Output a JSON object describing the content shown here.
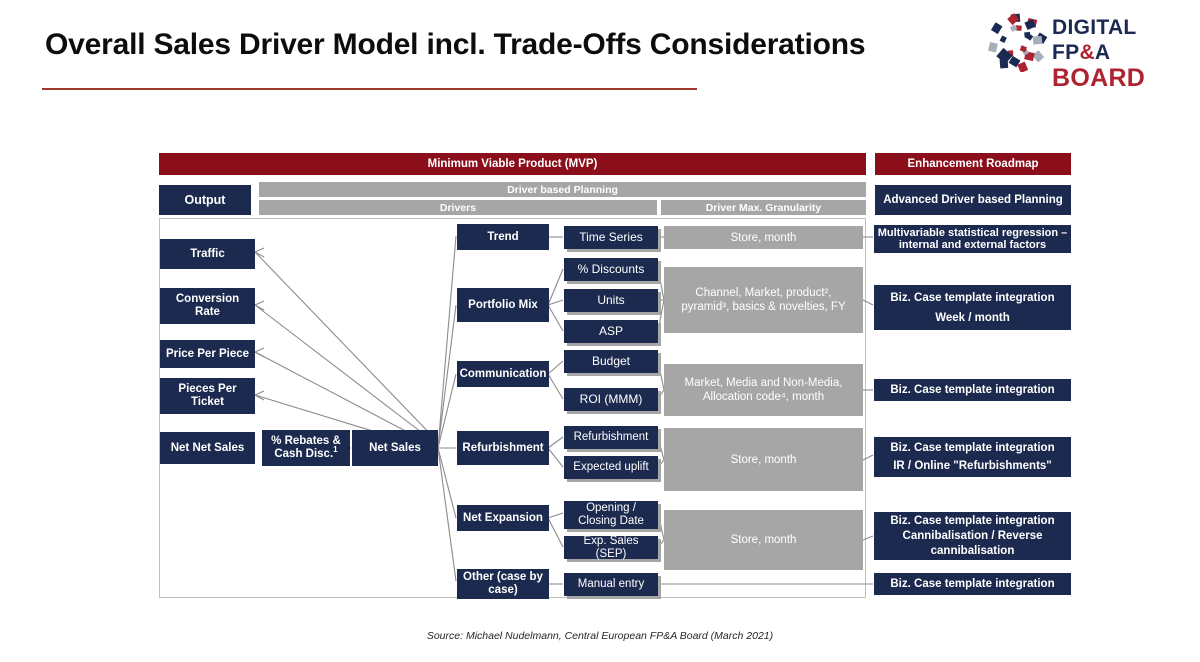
{
  "header": {
    "title": "Overall Sales Driver Model incl. Trade-Offs Considerations",
    "rule_color": "#9E3A2B",
    "logo": {
      "line1_pre": "DIGITAL FP",
      "line1_amp": "&",
      "line1_post": "A",
      "line2": "BOARD",
      "mark_name": "digital-fpa-board-swirl-logo",
      "colors": {
        "navy": "#1B2A52",
        "red": "#AE2330",
        "gray": "#A6AEBB"
      }
    }
  },
  "colors": {
    "navy": "#1B2A4E",
    "gray": "#A6A6A6",
    "dark_red": "#8B0E1B",
    "frame": "#BFBFBF",
    "connector": "#8C8C8C"
  },
  "banners": {
    "mvp": "Minimum Viable Product (MVP)",
    "enhancement_roadmap": "Enhancement Roadmap"
  },
  "row_labels": {
    "output": "Output",
    "driver_based_planning": "Driver based Planning",
    "drivers": "Drivers",
    "driver_max_granularity": "Driver Max. Granularity",
    "advanced_driver_based_planning": "Advanced Driver based Planning"
  },
  "output_metrics": [
    {
      "label": "Traffic"
    },
    {
      "label": "Conversion Rate"
    },
    {
      "label": "Price Per Piece"
    },
    {
      "label": "Pieces Per Ticket"
    },
    {
      "label": "Net Net Sales"
    }
  ],
  "bridge_boxes": [
    {
      "name": "rebates-cash-discount",
      "label": "% Rebates & Cash Disc.",
      "footnote": "1"
    },
    {
      "name": "net-sales",
      "label": "Net Sales",
      "footnote": ""
    }
  ],
  "drivers": [
    {
      "name": "trend",
      "label": "Trend",
      "sub_drivers": [
        {
          "label": "Time Series"
        }
      ],
      "granularity": {
        "lines": [
          "Store, month"
        ],
        "footnotes": []
      },
      "roadmap": {
        "lines": [
          "Multivariable statistical regression – internal and external factors"
        ]
      }
    },
    {
      "name": "portfolio-mix",
      "label": "Portfolio Mix",
      "sub_drivers": [
        {
          "label": "% Discounts"
        },
        {
          "label": "Units"
        },
        {
          "label": "ASP"
        }
      ],
      "granularity": {
        "lines": [
          "Channel, Market, product²,",
          "pyramid³, basics & novelties, FY"
        ],
        "footnotes": [
          "2",
          "3"
        ]
      },
      "roadmap": {
        "lines": [
          "Biz. Case template integration",
          "Week / month"
        ]
      }
    },
    {
      "name": "communication",
      "label": "Communication",
      "sub_drivers": [
        {
          "label": "Budget"
        },
        {
          "label": "ROI (MMM)"
        }
      ],
      "granularity": {
        "lines": [
          "Market, Media and Non-Media,",
          "Allocation code⁴, month"
        ],
        "footnotes": [
          "4"
        ]
      },
      "roadmap": {
        "lines": [
          "Biz. Case template integration"
        ]
      }
    },
    {
      "name": "refurbishment",
      "label": "Refurbishment",
      "sub_drivers": [
        {
          "label": "Refurbishment"
        },
        {
          "label": "Expected uplift"
        }
      ],
      "granularity": {
        "lines": [
          "Store, month"
        ],
        "footnotes": []
      },
      "roadmap": {
        "lines": [
          "Biz. Case template integration",
          "IR / Online \"Refurbishments\""
        ]
      }
    },
    {
      "name": "net-expansion",
      "label": "Net Expansion",
      "sub_drivers": [
        {
          "label": "Opening / Closing Date"
        },
        {
          "label": "Exp. Sales (SEP)"
        }
      ],
      "granularity": {
        "lines": [
          "Store, month"
        ],
        "footnotes": []
      },
      "roadmap": {
        "lines": [
          "Biz. Case template integration",
          "Cannibalisation / Reverse cannibalisation"
        ]
      }
    },
    {
      "name": "other-case-by-case",
      "label": "Other (case by case)",
      "sub_drivers": [
        {
          "label": "Manual entry"
        }
      ],
      "granularity": {
        "lines": [],
        "footnotes": []
      },
      "roadmap": {
        "lines": [
          "Biz. Case template integration"
        ]
      }
    }
  ],
  "sub_driver_flat": [
    "Time Series",
    "% Discounts",
    "Units",
    "ASP",
    "Budget",
    "ROI (MMM)",
    "Refurbishment",
    "Expected uplift",
    "Opening / Closing Date",
    "Exp. Sales (SEP)",
    "Manual entry"
  ],
  "granularity_flat": [
    "Store, month",
    "Channel, Market, product², pyramid³, basics & novelties, FY",
    "Market, Media and Non-Media, Allocation code⁴, month",
    "Store, month",
    "Store, month"
  ],
  "roadmap_flat": [
    "Multivariable statistical regression – internal and external factors",
    "Biz. Case template integration / Week / month",
    "Biz. Case template integration",
    "Biz. Case template integration / IR / Online \"Refurbishments\"",
    "Biz. Case template integration / Cannibalisation / Reverse cannibalisation",
    "Biz. Case template integration"
  ],
  "footer": {
    "source": "Source: Michael Nudelmann, Central European FP&A Board (March 2021)"
  }
}
